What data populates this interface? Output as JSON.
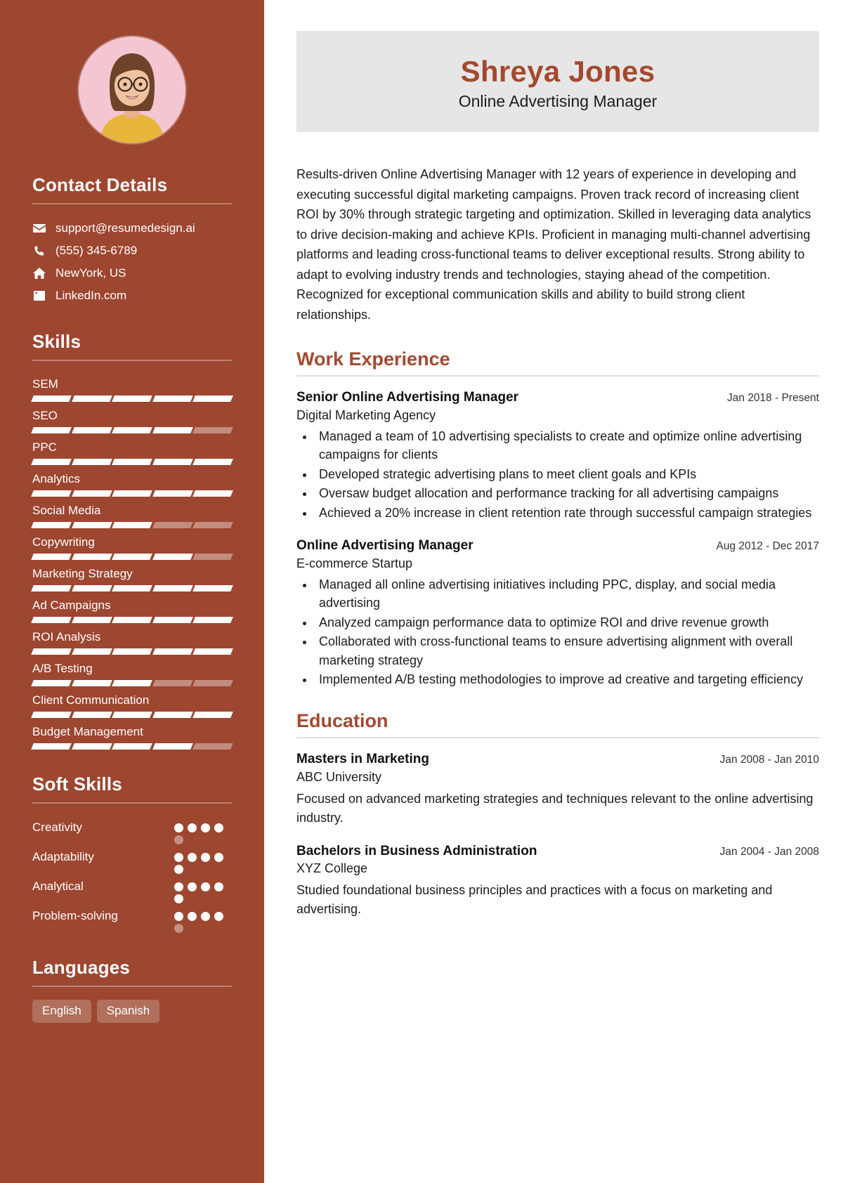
{
  "theme": {
    "sidebar_bg": "#9d4630",
    "accent": "#a4492f",
    "header_bg": "#e6e6e6",
    "tag_bg": "#b0705c",
    "avatar_bg": "#f3c6d2"
  },
  "header": {
    "name": "Shreya Jones",
    "job_title": "Online Advertising Manager"
  },
  "summary": "Results-driven Online Advertising Manager with 12 years of experience in developing and executing successful digital marketing campaigns. Proven track record of increasing client ROI by 30% through strategic targeting and optimization. Skilled in leveraging data analytics to drive decision-making and achieve KPIs. Proficient in managing multi-channel advertising platforms and leading cross-functional teams to deliver exceptional results. Strong ability to adapt to evolving industry trends and technologies, staying ahead of the competition. Recognized for exceptional communication skills and ability to build strong client relationships.",
  "sidebar": {
    "contact": {
      "heading": "Contact Details",
      "items": [
        {
          "icon": "envelope-icon",
          "value": "support@resumedesign.ai"
        },
        {
          "icon": "phone-icon",
          "value": "(555) 345-6789"
        },
        {
          "icon": "home-icon",
          "value": "NewYork, US"
        },
        {
          "icon": "linkedin-icon",
          "value": "LinkedIn.com"
        }
      ]
    },
    "skills": {
      "heading": "Skills",
      "max": 5,
      "items": [
        {
          "label": "SEM",
          "level": 5
        },
        {
          "label": "SEO",
          "level": 4
        },
        {
          "label": "PPC",
          "level": 5
        },
        {
          "label": "Analytics",
          "level": 5
        },
        {
          "label": "Social Media",
          "level": 3
        },
        {
          "label": "Copywriting",
          "level": 4
        },
        {
          "label": "Marketing Strategy",
          "level": 5
        },
        {
          "label": "Ad Campaigns",
          "level": 5
        },
        {
          "label": "ROI Analysis",
          "level": 5
        },
        {
          "label": "A/B Testing",
          "level": 3
        },
        {
          "label": "Client Communication",
          "level": 5
        },
        {
          "label": "Budget Management",
          "level": 4
        }
      ]
    },
    "soft_skills": {
      "heading": "Soft Skills",
      "max": 5,
      "items": [
        {
          "label": "Creativity",
          "level": 4
        },
        {
          "label": "Adaptability",
          "level": 5
        },
        {
          "label": "Analytical",
          "level": 5
        },
        {
          "label": "Problem-solving",
          "level": 4
        }
      ]
    },
    "languages": {
      "heading": "Languages",
      "items": [
        "English",
        "Spanish"
      ]
    }
  },
  "main": {
    "work": {
      "heading": "Work Experience",
      "entries": [
        {
          "title": "Senior Online Advertising Manager",
          "organization": "Digital Marketing Agency",
          "date": "Jan 2018 - Present",
          "bullets": [
            "Managed a team of 10 advertising specialists to create and optimize online advertising campaigns for clients",
            "Developed strategic advertising plans to meet client goals and KPIs",
            "Oversaw budget allocation and performance tracking for all advertising campaigns",
            "Achieved a 20% increase in client retention rate through successful campaign strategies"
          ]
        },
        {
          "title": "Online Advertising Manager",
          "organization": "E-commerce Startup",
          "date": "Aug 2012 - Dec 2017",
          "bullets": [
            "Managed all online advertising initiatives including PPC, display, and social media advertising",
            "Analyzed campaign performance data to optimize ROI and drive revenue growth",
            "Collaborated with cross-functional teams to ensure advertising alignment with overall marketing strategy",
            "Implemented A/B testing methodologies to improve ad creative and targeting efficiency"
          ]
        }
      ]
    },
    "education": {
      "heading": "Education",
      "entries": [
        {
          "title": "Masters in Marketing",
          "organization": "ABC University",
          "date": "Jan 2008 - Jan 2010",
          "description": "Focused on advanced marketing strategies and techniques relevant to the online advertising industry."
        },
        {
          "title": "Bachelors in Business Administration",
          "organization": "XYZ College",
          "date": "Jan 2004 - Jan 2008",
          "description": "Studied foundational business principles and practices with a focus on marketing and advertising."
        }
      ]
    }
  }
}
